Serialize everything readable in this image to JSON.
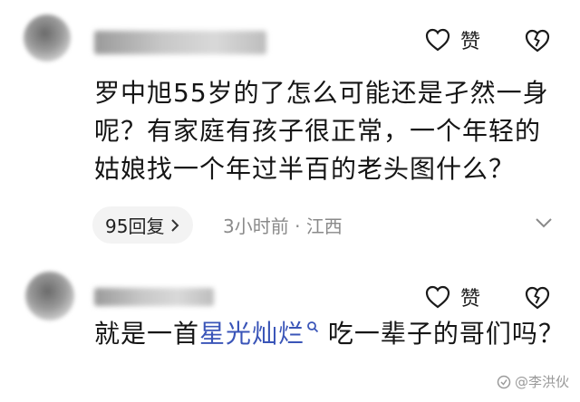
{
  "comments": [
    {
      "like_label": "赞",
      "text": "罗中旭55岁的了怎么可能还是孑然一身呢？有家庭有孩子很正常，一个年轻的姑娘找一个年过半百的老头图什么？",
      "replies": "95回复",
      "time": "3小时前",
      "separator": "·",
      "location": "江西"
    },
    {
      "like_label": "赞",
      "text_before": "就是一首",
      "highlight": "星光灿烂",
      "text_after": " 吃一辈子的哥们吗？"
    }
  ],
  "watermark": "@李洪伙",
  "colors": {
    "highlight": "#3a55b8",
    "meta": "#8a8a8a"
  },
  "icons": [
    "heart-icon",
    "broken-heart-icon",
    "chevron-right-icon",
    "share-icon",
    "search-icon"
  ]
}
